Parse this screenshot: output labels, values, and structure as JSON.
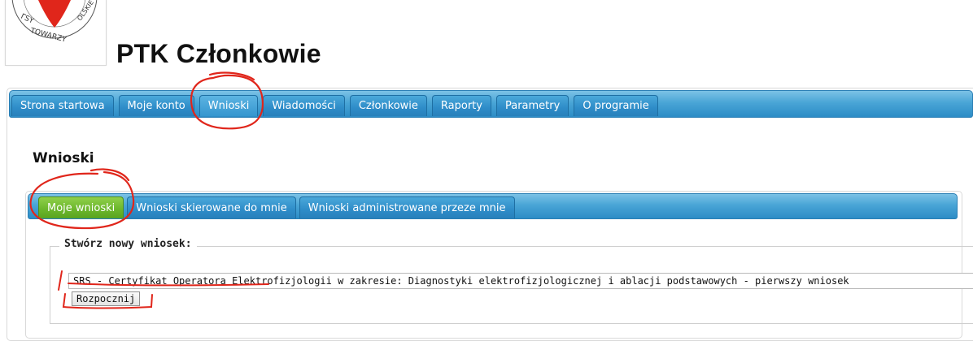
{
  "app": {
    "title": "PTK Członkowie"
  },
  "nav": {
    "tabs": [
      {
        "label": "Strona startowa"
      },
      {
        "label": "Moje konto"
      },
      {
        "label": "Wnioski",
        "active": true
      },
      {
        "label": "Wiadomości"
      },
      {
        "label": "Członkowie"
      },
      {
        "label": "Raporty"
      },
      {
        "label": "Parametry"
      },
      {
        "label": "O programie"
      }
    ]
  },
  "section": {
    "title": "Wnioski"
  },
  "subnav": {
    "tabs": [
      {
        "label": "Moje wnioski",
        "active": true
      },
      {
        "label": "Wnioski skierowane do mnie"
      },
      {
        "label": "Wnioski administrowane przeze mnie"
      }
    ]
  },
  "form": {
    "legend": "Stwórz nowy wniosek:",
    "select_value": "SRS - Certyfikat Operatora Elektrofizjologii w zakresie: Diagnostyki elektrofizjologicznej i ablacji podstawowych - pierwszy wniosek",
    "start_button": "Rozpocznij"
  },
  "logo": {
    "icon": "heart-logo-icon"
  },
  "colors": {
    "tab_blue": "#2e8cc8",
    "tab_active_green": "#6ab52a",
    "annotation_red": "#e0261b"
  }
}
